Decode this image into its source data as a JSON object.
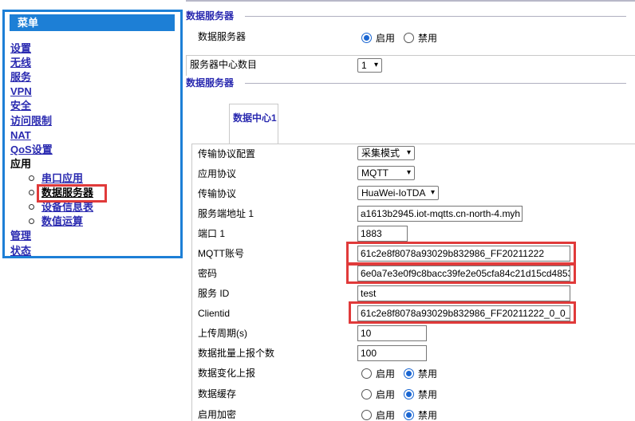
{
  "menu": {
    "header": "菜单",
    "items": [
      "设置",
      "无线",
      "服务",
      "VPN",
      "安全",
      "访问限制",
      "NAT",
      "QoS设置"
    ],
    "app_group": "应用",
    "sub_items": [
      "串口应用",
      "数据服务器",
      "设备信息表",
      "数值运算"
    ],
    "active_sub": "数据服务器",
    "bottom_items": [
      "管理",
      "状态"
    ]
  },
  "section1": {
    "title": "数据服务器",
    "server_label": "数据服务器",
    "enable": "启用",
    "disable": "禁用",
    "server_enabled": true,
    "count_label": "服务器中心数目",
    "count_value": "1"
  },
  "section2": {
    "title": "数据服务器",
    "tab_label": "数据中心1"
  },
  "fields": {
    "transport_config_label": "传输协议配置",
    "transport_config_value": "采集模式",
    "app_protocol_label": "应用协议",
    "app_protocol_value": "MQTT",
    "transport_protocol_label": "传输协议",
    "transport_protocol_value": "HuaWei-IoTDA",
    "server_addr_label": "服务端地址 1",
    "server_addr_value": "a1613b2945.iot-mqtts.cn-north-4.myh",
    "port_label": "端口 1",
    "port_value": "1883",
    "mqtt_account_label": "MQTT账号",
    "mqtt_account_value": "61c2e8f8078a93029b832986_FF20211222",
    "password_label": "密码",
    "password_value": "6e0a7e3e0f9c8bacc39fe2e05cfa84c21d15cd4853",
    "service_id_label": "服务 ID",
    "service_id_value": "test",
    "clientid_label": "Clientid",
    "clientid_value": "61c2e8f8078a93029b832986_FF20211222_0_0_",
    "upload_period_label": "上传周期(s)",
    "upload_period_value": "10",
    "batch_label": "数据批量上报个数",
    "batch_value": "100",
    "change_report_label": "数据变化上报",
    "cache_label": "数据缓存",
    "encrypt_label": "启用加密",
    "enable": "启用",
    "disable": "禁用"
  },
  "colors": {
    "accent_blue": "#1d7fd6",
    "link_blue": "#2a2ab0",
    "highlight_red": "#e03a3a"
  }
}
